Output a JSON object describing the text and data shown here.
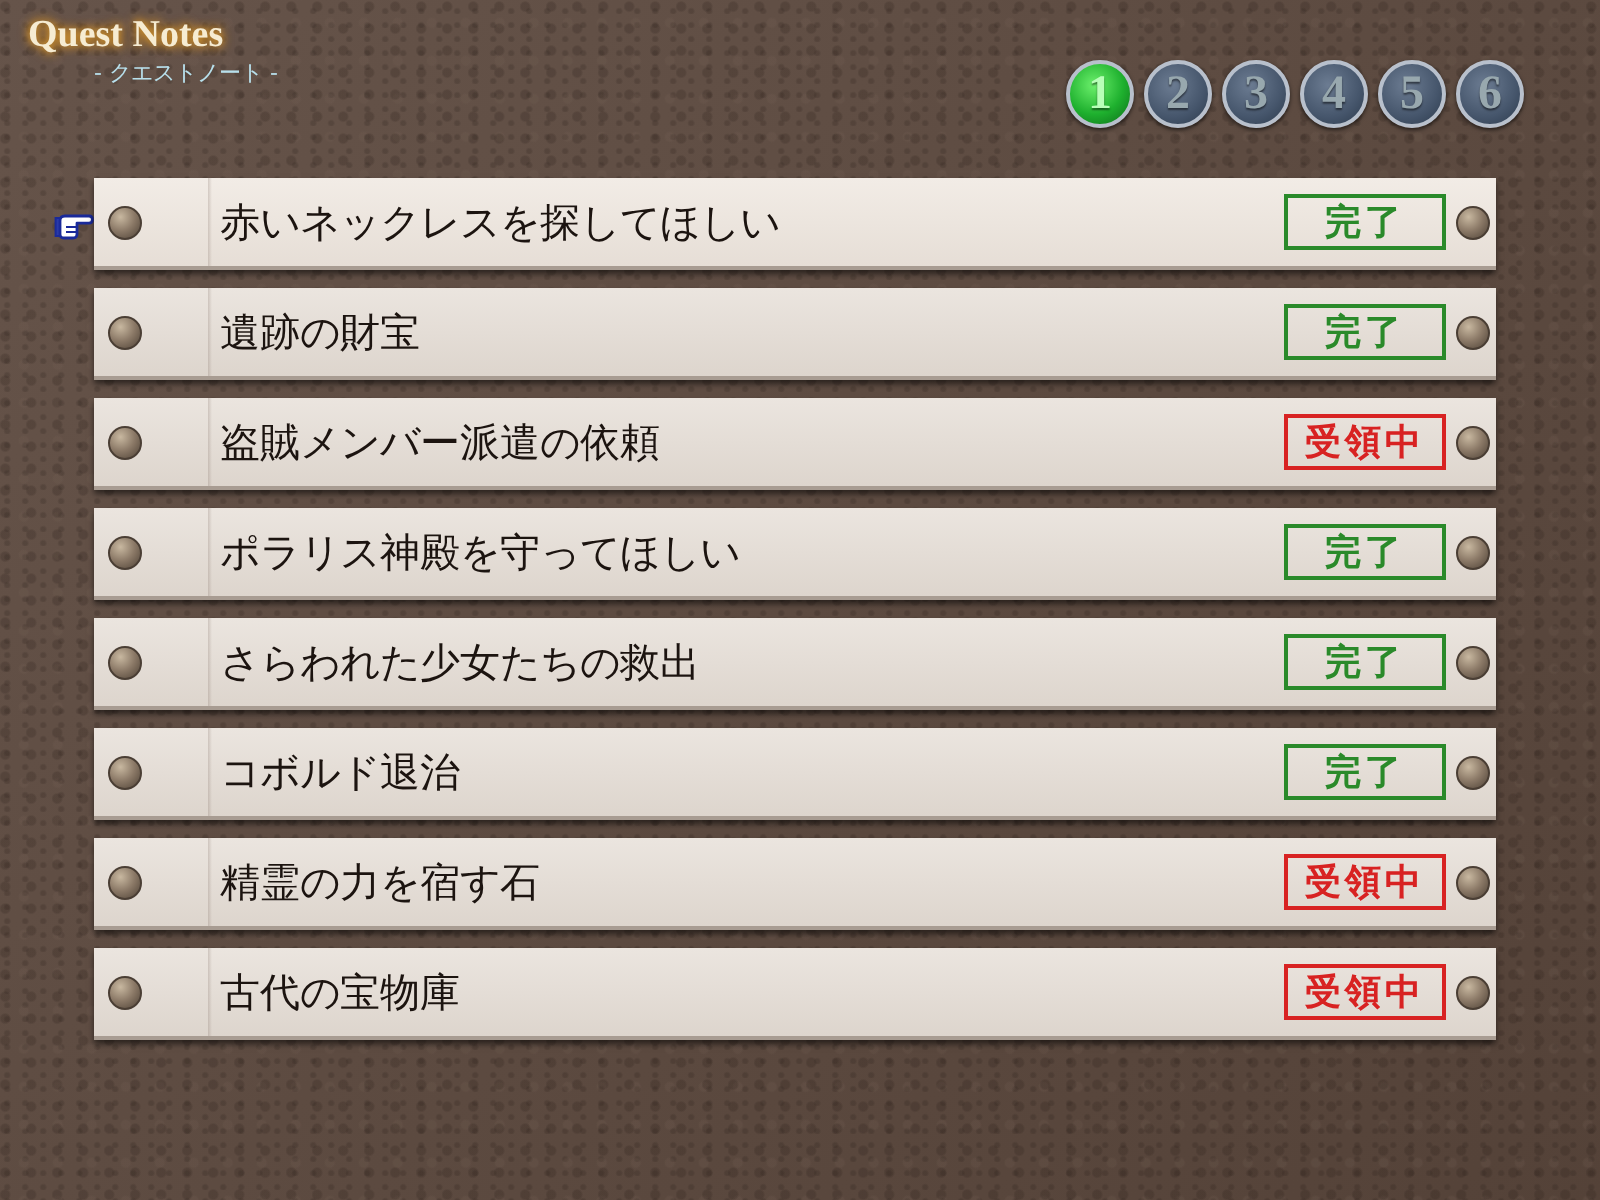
{
  "header": {
    "title": "Quest Notes",
    "subtitle": "- クエストノート -"
  },
  "pages": [
    {
      "label": "1",
      "selected": true
    },
    {
      "label": "2",
      "selected": false
    },
    {
      "label": "3",
      "selected": false
    },
    {
      "label": "4",
      "selected": false
    },
    {
      "label": "5",
      "selected": false
    },
    {
      "label": "6",
      "selected": false
    }
  ],
  "quests": [
    {
      "title": "赤いネックレスを探してほしい",
      "selected": true,
      "status": {
        "label": "完了",
        "kind": "done"
      }
    },
    {
      "title": "遺跡の財宝",
      "selected": false,
      "status": {
        "label": "完了",
        "kind": "done"
      }
    },
    {
      "title": "盗賊メンバー派遣の依頼",
      "selected": false,
      "status": {
        "label": "受領中",
        "kind": "active"
      }
    },
    {
      "title": "ポラリス神殿を守ってほしい",
      "selected": false,
      "status": {
        "label": "完了",
        "kind": "done"
      }
    },
    {
      "title": "さらわれた少女たちの救出",
      "selected": false,
      "status": {
        "label": "完了",
        "kind": "done"
      }
    },
    {
      "title": "コボルド退治",
      "selected": false,
      "status": {
        "label": "完了",
        "kind": "done"
      }
    },
    {
      "title": "精霊の力を宿す石",
      "selected": false,
      "status": {
        "label": "受領中",
        "kind": "active"
      }
    },
    {
      "title": "古代の宝物庫",
      "selected": false,
      "status": {
        "label": "受領中",
        "kind": "active"
      }
    }
  ]
}
